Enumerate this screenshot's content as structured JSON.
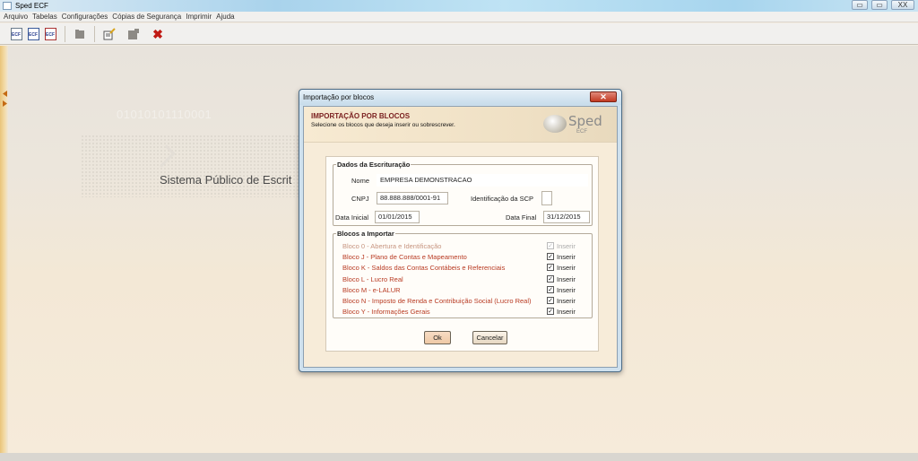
{
  "window": {
    "title": "Sped ECF",
    "controls": [
      "▭",
      "▭",
      "XX"
    ]
  },
  "menu": [
    "Arquivo",
    "Tabelas",
    "Configurações",
    "Cópias de Segurança",
    "Imprimir",
    "Ajuda"
  ],
  "toolbar": {
    "icons": [
      "ecf-new-icon",
      "ecf-open-icon",
      "ecf-import-icon",
      "folder-icon",
      "edit-icon",
      "document-icon",
      "delete-icon"
    ],
    "delete_glyph": "✖",
    "badge": "ECF"
  },
  "background": {
    "binary_text": "01010101110001",
    "system_title": "Sistema Público de Escrit"
  },
  "dialog": {
    "title": "Importação por blocos",
    "close_glyph": "✕",
    "header_title": "IMPORTAÇÃO POR BLOCOS",
    "header_subtitle": "Selecione os blocos que deseja inserir ou sobrescrever.",
    "logo_word": "Sped",
    "logo_sub": "ECF",
    "dados": {
      "legend": "Dados da Escrituração",
      "nome_label": "Nome",
      "nome_value": "EMPRESA DEMONSTRACAO",
      "cnpj_label": "CNPJ",
      "cnpj_value": "88.888.888/0001-91",
      "scp_label": "Identificação da SCP",
      "scp_value": "",
      "data_inicial_label": "Data Inicial",
      "data_inicial_value": "01/01/2015",
      "data_final_label": "Data Final",
      "data_final_value": "31/12/2015"
    },
    "blocos": {
      "legend": "Blocos a Importar",
      "check_label": "Inserir",
      "items": [
        {
          "label": "Bloco 0 - Abertura e Identificação",
          "checked": true,
          "enabled": false
        },
        {
          "label": "Bloco J - Plano de Contas e Mapeamento",
          "checked": true,
          "enabled": true
        },
        {
          "label": "Bloco K - Saldos das Contas Contábeis e Referenciais",
          "checked": true,
          "enabled": true
        },
        {
          "label": "Bloco L - Lucro Real",
          "checked": true,
          "enabled": true
        },
        {
          "label": "Bloco M - e-LALUR",
          "checked": true,
          "enabled": true
        },
        {
          "label": "Bloco N - Imposto de Renda e Contribuição Social (Lucro Real)",
          "checked": true,
          "enabled": true
        },
        {
          "label": "Bloco Y - Informações Gerais",
          "checked": true,
          "enabled": true
        }
      ]
    },
    "ok_label": "Ok",
    "cancel_label": "Cancelar"
  }
}
